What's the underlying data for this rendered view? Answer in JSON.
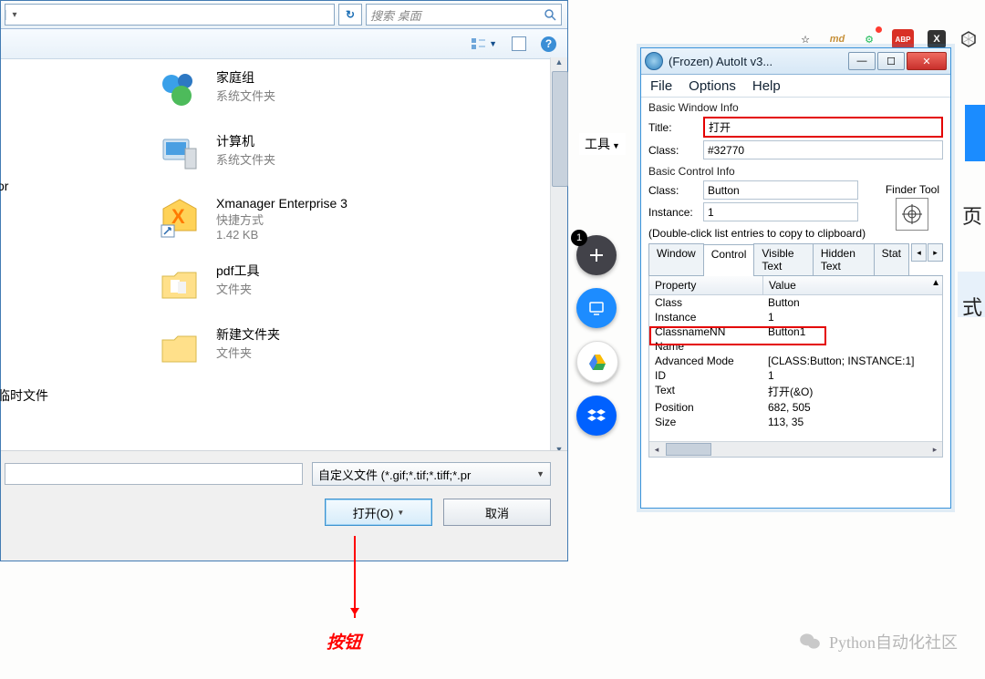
{
  "file_dialog": {
    "search_placeholder": "搜索 桌面",
    "toolbar": {
      "help": "?"
    },
    "side": {
      "item_or": "or",
      "item_temp": "临时文件"
    },
    "items": [
      {
        "name": "家庭组",
        "sub1": "系统文件夹"
      },
      {
        "name": "计算机",
        "sub1": "系统文件夹"
      },
      {
        "name": "Xmanager Enterprise 3",
        "sub1": "快捷方式",
        "sub2": "1.42 KB"
      },
      {
        "name": "pdf工具",
        "sub1": "文件夹"
      },
      {
        "name": "新建文件夹",
        "sub1": "文件夹"
      }
    ],
    "filter": "自定义文件 (*.gif;*.tif;*.tiff;*.pr",
    "btn_open": "打开(O)",
    "btn_cancel": "取消"
  },
  "annotation": {
    "label": "按钮"
  },
  "toolbar_strip": {
    "label": "工具"
  },
  "fab": {
    "badge": "1"
  },
  "right_text": {
    "a": "页",
    "b": "式"
  },
  "autoit": {
    "title": "(Frozen) AutoIt v3...",
    "menu": {
      "file": "File",
      "options": "Options",
      "help": "Help"
    },
    "basic_window": {
      "group": "Basic Window Info",
      "title_label": "Title:",
      "title_value": "打开",
      "class_label": "Class:",
      "class_value": "#32770"
    },
    "basic_control": {
      "group": "Basic Control Info",
      "class_label": "Class:",
      "class_value": "Button",
      "instance_label": "Instance:",
      "instance_value": "1"
    },
    "finder": "Finder Tool",
    "hint": "(Double-click list entries to copy to clipboard)",
    "tabs": [
      "Window",
      "Control",
      "Visible Text",
      "Hidden Text",
      "Stat"
    ],
    "active_tab": 1,
    "props_header": {
      "p": "Property",
      "v": "Value"
    },
    "props": [
      {
        "p": "Class",
        "v": "Button"
      },
      {
        "p": "Instance",
        "v": "1"
      },
      {
        "p": "ClassnameNN",
        "v": "Button1"
      },
      {
        "p": "Name",
        "v": ""
      },
      {
        "p": "Advanced Mode",
        "v": "[CLASS:Button; INSTANCE:1]"
      },
      {
        "p": "ID",
        "v": "1"
      },
      {
        "p": "Text",
        "v": "打开(&O)"
      },
      {
        "p": "Position",
        "v": "682, 505"
      },
      {
        "p": "Size",
        "v": "113, 35"
      }
    ]
  },
  "watermark": "Python自动化社区"
}
